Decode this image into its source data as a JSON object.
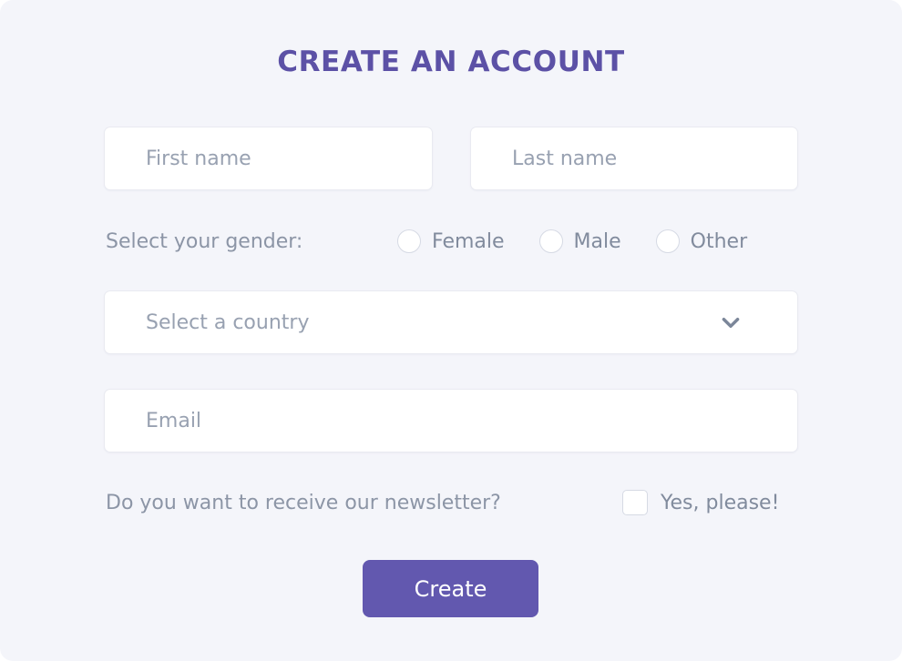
{
  "card": {
    "background_color": "#f4f5fa"
  },
  "form": {
    "title": "CREATE AN ACCOUNT",
    "title_color": "#5c51a6",
    "first_name": {
      "placeholder": "First name",
      "value": ""
    },
    "last_name": {
      "placeholder": "Last name",
      "value": ""
    },
    "gender": {
      "prompt": "Select your gender:",
      "selected": "",
      "options": [
        {
          "label": "Female",
          "checked": false
        },
        {
          "label": "Male",
          "checked": false
        },
        {
          "label": "Other",
          "checked": false
        }
      ]
    },
    "country": {
      "selected_label": "Select a country",
      "icon": "chevron-down-icon",
      "icon_color": "#7b8699"
    },
    "email": {
      "placeholder": "Email",
      "value": ""
    },
    "newsletter": {
      "prompt": "Do you want to receive our newsletter?",
      "checkbox_label": "Yes, please!",
      "checked": false
    },
    "submit": {
      "label": "Create",
      "background_color": "#6258af",
      "text_color": "#ffffff"
    }
  }
}
